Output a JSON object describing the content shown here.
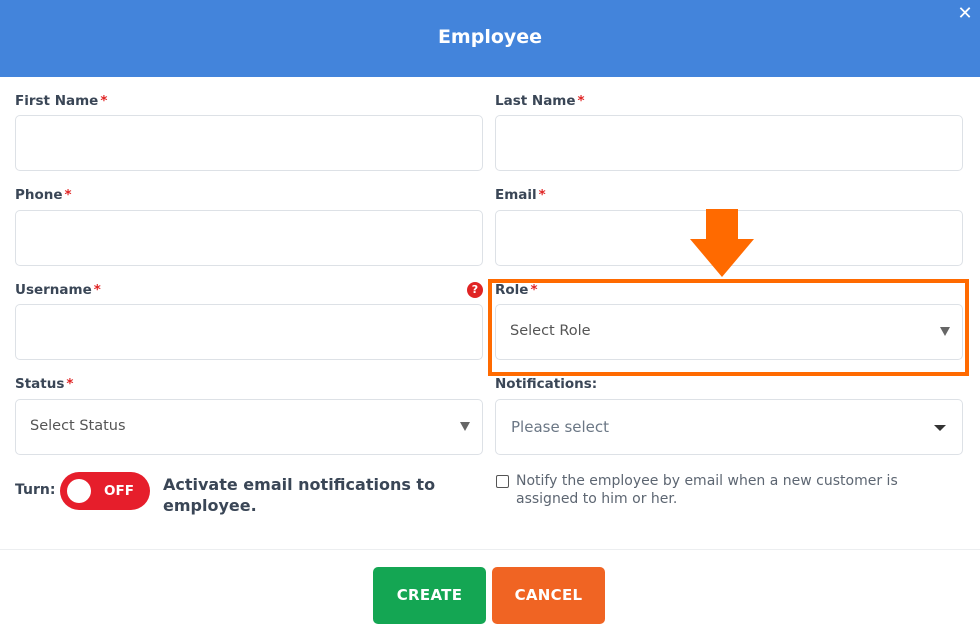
{
  "dialog": {
    "title": "Employee",
    "close_icon": "close-icon"
  },
  "fields": {
    "first_name": {
      "label": "First Name",
      "required_mark": "*",
      "value": ""
    },
    "last_name": {
      "label": "Last Name",
      "required_mark": "*",
      "value": ""
    },
    "phone": {
      "label": "Phone",
      "required_mark": "*",
      "value": ""
    },
    "email": {
      "label": "Email",
      "required_mark": "*",
      "value": ""
    },
    "username": {
      "label": "Username",
      "required_mark": "*",
      "value": "",
      "help_icon": "?"
    },
    "role": {
      "label": "Role",
      "required_mark": "*",
      "selected": "Select Role"
    },
    "status": {
      "label": "Status",
      "required_mark": "*",
      "selected": "Select Status"
    },
    "notifications": {
      "label": "Notifications:",
      "selected": "Please select"
    }
  },
  "toggle": {
    "label": "Turn:",
    "state": "OFF",
    "description": "Activate email notifications to employee."
  },
  "checkbox": {
    "checked": false,
    "label": "Notify the employee by email when a new customer is assigned to him or her."
  },
  "annotation": {
    "color": "#ff6a00",
    "target": "role"
  },
  "buttons": {
    "create": "CREATE",
    "cancel": "CANCEL"
  },
  "colors": {
    "header": "#4384db",
    "create": "#14a653",
    "cancel": "#f06423",
    "toggle_off": "#e61e2b",
    "required": "#e02424"
  }
}
